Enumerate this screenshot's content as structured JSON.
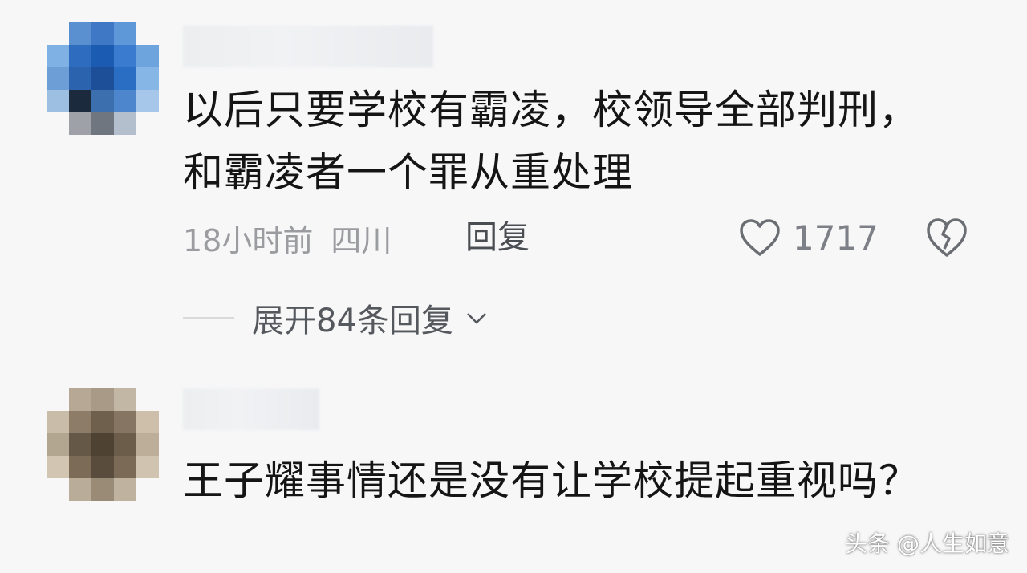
{
  "comments": [
    {
      "text": "以后只要学校有霸凌，校领导全部判刑，和霸凌者一个罪从重处理",
      "time": "18小时前",
      "region": "四川",
      "reply_label": "回复",
      "like_count": "1717",
      "expand_label": "展开84条回复"
    },
    {
      "text": "王子耀事情还是没有让学校提起重视吗？"
    }
  ],
  "watermark": "头条 @人生如意",
  "icons": {
    "like": "heart-outline-icon",
    "dislike": "broken-heart-icon",
    "expand": "chevron-down-icon"
  },
  "colors": {
    "background": "#f7f7f8",
    "text": "#151515",
    "meta": "#9a9ca0"
  }
}
